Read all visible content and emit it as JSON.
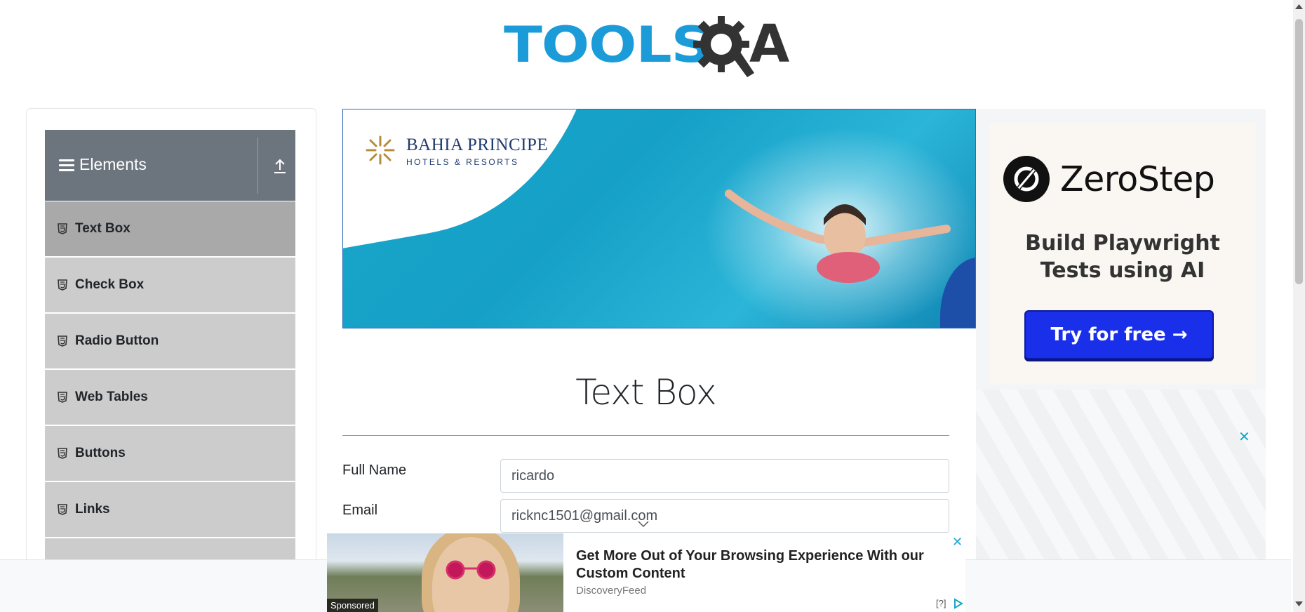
{
  "header": {
    "logo_text": "TOOLS",
    "logo_suffix": "A"
  },
  "sidebar": {
    "group_title": "Elements",
    "items": [
      {
        "label": "Text Box",
        "active": true
      },
      {
        "label": "Check Box",
        "active": false
      },
      {
        "label": "Radio Button",
        "active": false
      },
      {
        "label": "Web Tables",
        "active": false
      },
      {
        "label": "Buttons",
        "active": false
      },
      {
        "label": "Links",
        "active": false
      }
    ]
  },
  "banner_ad": {
    "brand": "BAHIA PRINCIPE",
    "brand_sub": "HOTELS & RESORTS"
  },
  "right_ad": {
    "name": "ZeroStep",
    "tagline_1": "Build Playwright",
    "tagline_2": "Tests using AI",
    "cta": "Try for free →",
    "close": "✕"
  },
  "main": {
    "title": "Text Box",
    "fields": [
      {
        "label": "Full Name",
        "value": "ricardo"
      },
      {
        "label": "Email",
        "value": "ricknc1501@gmail.com"
      }
    ]
  },
  "sponsored_ad": {
    "label": "Sponsored",
    "headline": "Get More Out of Your Browsing Experience With our Custom Content",
    "source": "DiscoveryFeed",
    "help": "[?]",
    "close": "✕"
  },
  "colors": {
    "accent": "#1b9cd9",
    "sidebar_header": "#6c757d",
    "menu_item": "#cccccc",
    "menu_active": "#a9a9a9",
    "cta": "#1a2fea"
  }
}
